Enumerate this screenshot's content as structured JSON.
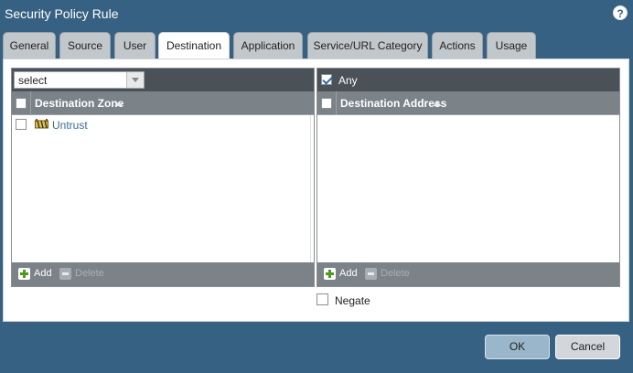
{
  "window": {
    "title": "Security Policy Rule",
    "help_icon": "?"
  },
  "tabs": [
    {
      "label": "General"
    },
    {
      "label": "Source"
    },
    {
      "label": "User"
    },
    {
      "label": "Destination",
      "active": true
    },
    {
      "label": "Application"
    },
    {
      "label": "Service/URL Category"
    },
    {
      "label": "Actions"
    },
    {
      "label": "Usage"
    }
  ],
  "left_panel": {
    "select_value": "select",
    "column_header": "Destination Zone",
    "rows": [
      {
        "label": "Untrust",
        "icon": "zone-icon",
        "checked": false
      }
    ],
    "add_label": "Add",
    "delete_label": "Delete"
  },
  "right_panel": {
    "any_label": "Any",
    "any_checked": true,
    "column_header": "Destination Address",
    "add_label": "Add",
    "delete_label": "Delete"
  },
  "negate": {
    "label": "Negate",
    "checked": false
  },
  "footer": {
    "ok_label": "OK",
    "cancel_label": "Cancel"
  },
  "colors": {
    "titlebar_bg": "#376182",
    "panel_header_bg": "#4b5158",
    "column_header_bg": "#7b8288",
    "link_text": "#3c6d92",
    "add_icon": "#4c9a22"
  }
}
